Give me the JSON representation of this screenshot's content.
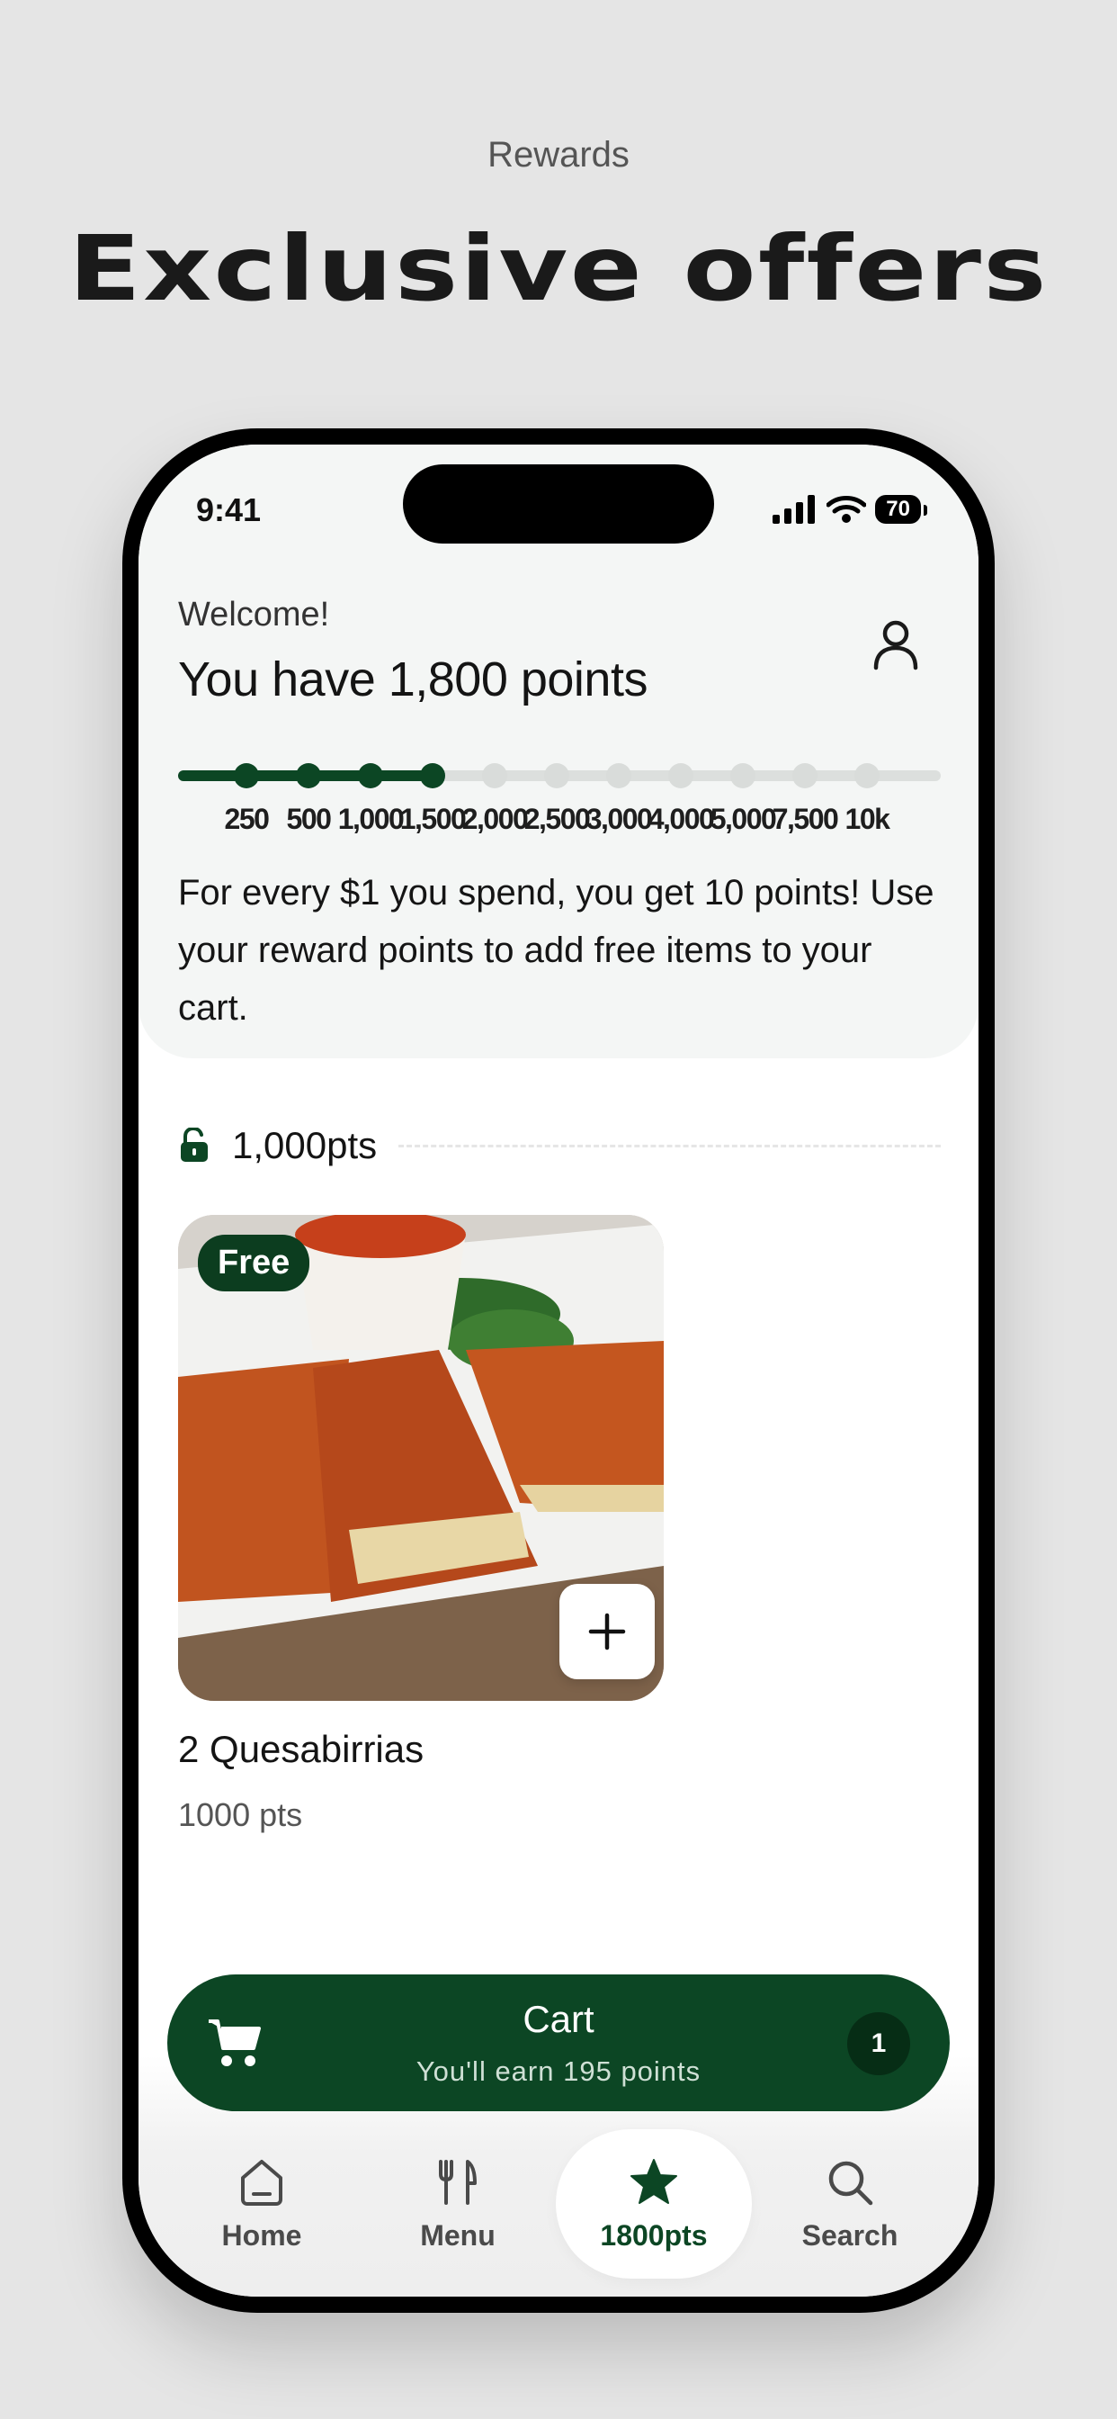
{
  "page": {
    "eyebrow": "Rewards",
    "headline": "Exclusive offers"
  },
  "status_bar": {
    "time": "9:41",
    "battery": "70"
  },
  "header": {
    "welcome": "Welcome!",
    "points_title": "You have 1,800 points",
    "profile_icon": "person-icon"
  },
  "progress": {
    "current_points": 1800,
    "ticks": [
      "250",
      "500",
      "1,000",
      "1,500",
      "2,000",
      "2,500",
      "3,000",
      "4,000",
      "5,000",
      "7,500",
      "10k"
    ],
    "ticks_reached": 4,
    "fill_fraction": 0.34
  },
  "description": "For every $1 you spend, you get 10 points! Use your reward points to add free items to your cart.",
  "section": {
    "label": "1,000pts",
    "icon": "unlocked-lock-icon"
  },
  "item": {
    "badge": "Free",
    "name": "2 Quesabirrias",
    "points": "1000 pts",
    "add_icon": "plus-icon"
  },
  "cart": {
    "title": "Cart",
    "subtitle": "You'll earn 195 points",
    "count": "1",
    "icon": "cart-icon"
  },
  "tabs": [
    {
      "label": "Home",
      "icon": "home-icon"
    },
    {
      "label": "Menu",
      "icon": "fork-knife-icon"
    },
    {
      "label": "1800pts",
      "icon": "star-icon",
      "active": true
    },
    {
      "label": "Search",
      "icon": "search-icon"
    }
  ],
  "colors": {
    "brand": "#0c4624",
    "background": "#e5e5e5",
    "header_bg": "#f4f6f5"
  }
}
